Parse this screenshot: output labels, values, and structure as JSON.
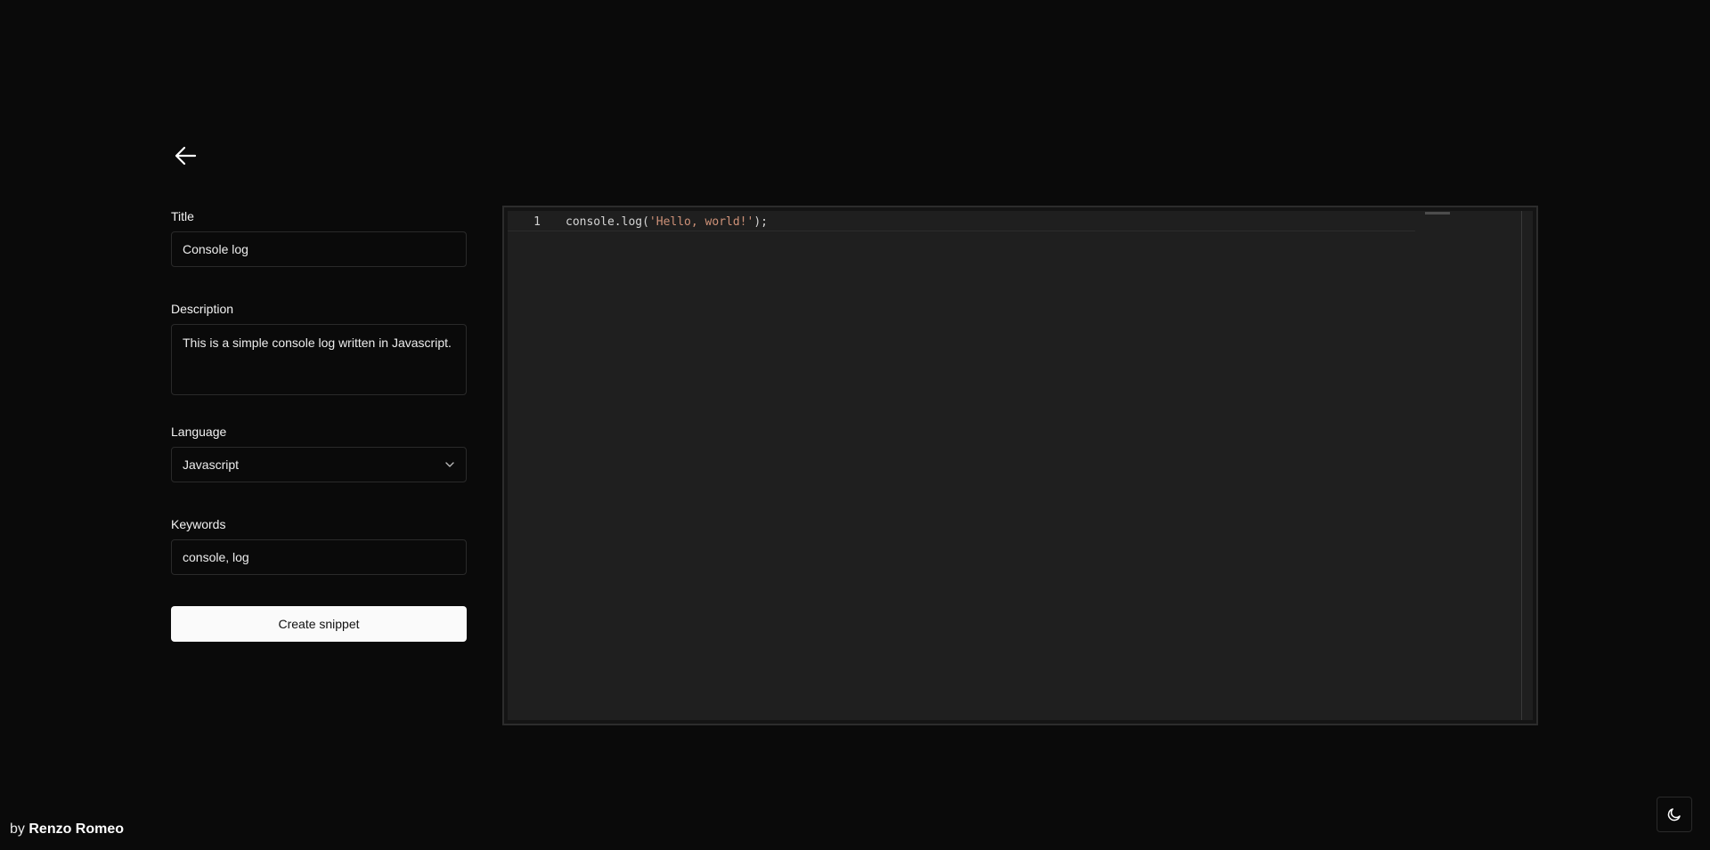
{
  "form": {
    "title_label": "Title",
    "title_value": "Console log",
    "description_label": "Description",
    "description_value": "This is a simple console log written in Javascript.",
    "language_label": "Language",
    "language_value": "Javascript",
    "keywords_label": "Keywords",
    "keywords_value": "console, log",
    "submit_label": "Create snippet"
  },
  "editor": {
    "line_number": "1",
    "code_prefix": "console.log(",
    "code_string": "'Hello, world!'",
    "code_suffix": ");",
    "string_color": "#ce9178"
  },
  "footer": {
    "by_text": "by",
    "author": "Renzo Romeo"
  },
  "icons": {
    "back": "arrow-left-icon",
    "select": "chevron-down-icon",
    "theme": "moon-icon"
  }
}
